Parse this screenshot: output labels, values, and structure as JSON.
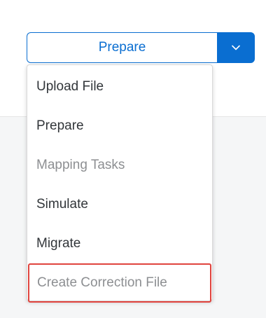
{
  "split_button": {
    "label": "Prepare",
    "arrow_icon": "chevron-down-icon",
    "accent_color": "#0a6ed1"
  },
  "menu": {
    "items": [
      {
        "label": "Upload File",
        "enabled": true
      },
      {
        "label": "Prepare",
        "enabled": true
      },
      {
        "label": "Mapping Tasks",
        "enabled": false
      },
      {
        "label": "Simulate",
        "enabled": true
      },
      {
        "label": "Migrate",
        "enabled": true
      },
      {
        "label": "Create Correction File",
        "enabled": false,
        "highlighted": true
      }
    ],
    "highlight_color": "#e0443e"
  }
}
